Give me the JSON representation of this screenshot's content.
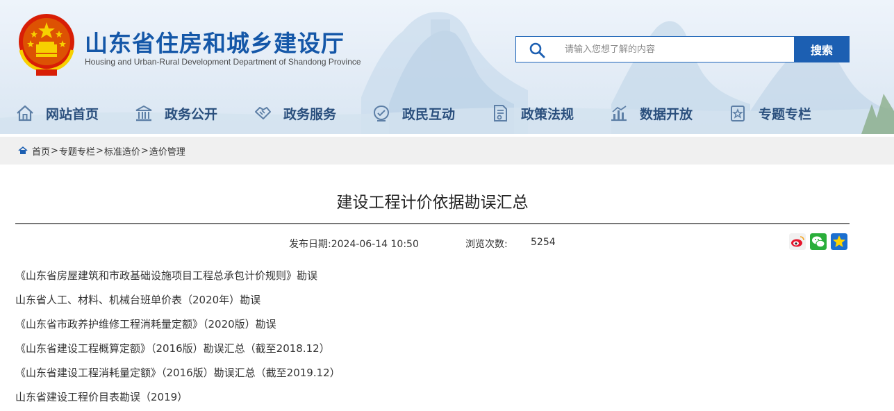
{
  "header": {
    "title": "山东省住房和城乡建设厅",
    "subtitle": "Housing and Urban-Rural Development Department of Shandong Province",
    "search_placeholder": "请输入您想了解的内容",
    "search_button": "搜索"
  },
  "nav": {
    "items": [
      {
        "label": "网站首页",
        "icon": "home-icon"
      },
      {
        "label": "政务公开",
        "icon": "government-building-icon"
      },
      {
        "label": "政务服务",
        "icon": "handshake-icon"
      },
      {
        "label": "政民互动",
        "icon": "interaction-icon"
      },
      {
        "label": "政策法规",
        "icon": "policy-document-icon"
      },
      {
        "label": "数据开放",
        "icon": "data-chart-icon"
      },
      {
        "label": "专题专栏",
        "icon": "topic-star-icon"
      }
    ]
  },
  "breadcrumb": {
    "items": [
      "首页",
      "专题专栏",
      "标准造价",
      "造价管理"
    ],
    "separator": ">"
  },
  "article": {
    "title": "建设工程计价依据勘误汇总",
    "publish_label": "发布日期:2024-06-14 10:50",
    "views_label": "浏览次数:",
    "views_count": "5254",
    "share_icons": [
      "weibo-icon",
      "wechat-icon",
      "favorite-star-icon"
    ],
    "documents": [
      "《山东省房屋建筑和市政基础设施项目工程总承包计价规则》勘误",
      "山东省人工、材料、机械台班单价表（2020年）勘误",
      "《山东省市政养护维修工程消耗量定额》（2020版）勘误",
      "《山东省建设工程概算定额》（2016版）勘误汇总（截至2018.12）",
      "《山东省建设工程消耗量定额》（2016版）勘误汇总（截至2019.12）",
      "山东省建设工程价目表勘误（2019）"
    ]
  },
  "colors": {
    "brand_blue": "#1457a8",
    "search_button": "#1c5fb2",
    "nav_text": "#2a4f7d",
    "breadcrumb_bg": "#f0f0f0"
  }
}
